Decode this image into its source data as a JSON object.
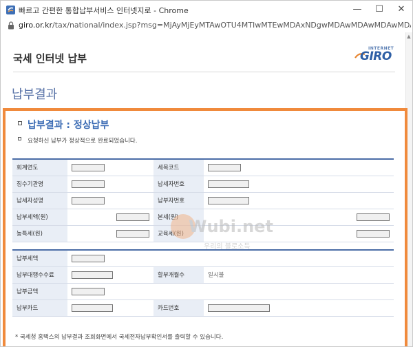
{
  "window": {
    "title": "빠르고 간편한 통합납부서비스 인터넷지로 - Chrome",
    "minimize_symbol": "—",
    "maximize_symbol": "☐",
    "close_symbol": "✕"
  },
  "address": {
    "host": "giro.or.kr",
    "path": "/tax/national/index.jsp?msg=MjAyMjEyMTAwOTU4MTIwMTEwMDAxNDgwMDAwMDAwMDAwMDAwMDAwMD..."
  },
  "header": {
    "site_title": "국세 인터넷 납부",
    "logo_small": "INTERNET",
    "logo_main": "GIRO"
  },
  "section_title": "납부결과",
  "result": {
    "title": "납부결과 : 정상납부",
    "message": "요청하신 납부가 정상적으로 완료되었습니다."
  },
  "table1": {
    "rows": [
      {
        "l1": "회계연도",
        "l2": "세목코드"
      },
      {
        "l1": "징수기관명",
        "l2": "납세자번호"
      },
      {
        "l1": "납세자성명",
        "l2": "납부자번호"
      },
      {
        "l1": "납부세액(원)",
        "l2": "본세(원)"
      },
      {
        "l1": "농특세(원)",
        "l2": "교육세(원)"
      }
    ]
  },
  "table2": {
    "r1_label": "납부세액",
    "r2_label": "납부대행수수료",
    "r2_label2": "할부개월수",
    "r2_value2": "일시불",
    "r3_label": "납부금액",
    "r4_label": "납부카드",
    "r4_label2": "카드번호"
  },
  "footnote": "* 국세청 홈택스의 납부결과 조회화면에서 국세전자납부확인서를 출력할 수 있습니다.",
  "watermark": {
    "text": "Wubi.net",
    "sub": "우리의 블로소득"
  },
  "colors": {
    "highlight_border": "#f08a3c",
    "accent_blue": "#3c6cb4",
    "table_header_bg": "#e9eef6"
  }
}
